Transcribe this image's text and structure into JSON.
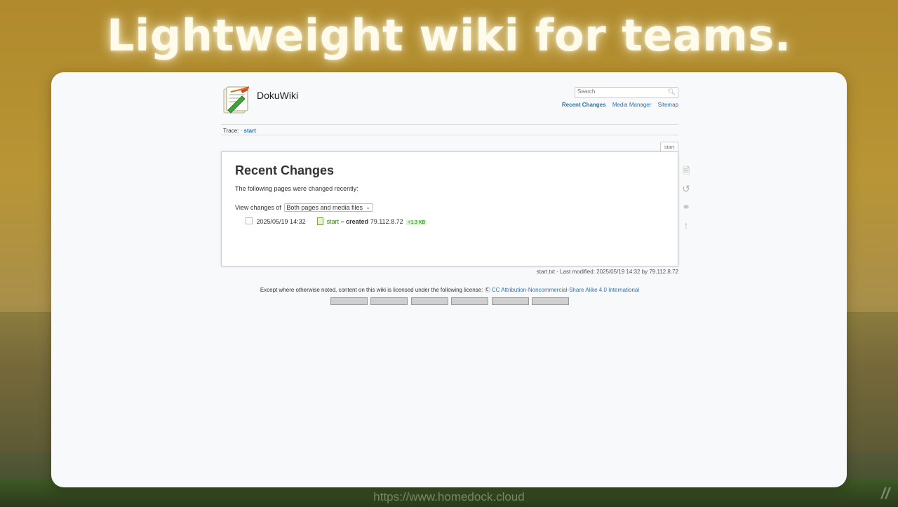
{
  "headline": "Lightweight wiki for teams.",
  "watermark": "https://www.homedock.cloud",
  "wiki": {
    "site_title": "DokuWiki",
    "search_placeholder": "Search",
    "top_links": [
      "Recent Changes",
      "Media Manager",
      "Sitemap"
    ],
    "trace_label": "Trace:",
    "trace_sep": "·",
    "trace_link": "start",
    "page_tab": "start",
    "heading": "Recent Changes",
    "intro": "The following pages were changed recently:",
    "view_changes_label": "View changes of",
    "view_changes_selected": "Both pages and media files",
    "changes": [
      {
        "date": "2025/05/19 14:32",
        "page": "start",
        "action": "– created",
        "ip": "79.112.8.72",
        "size_delta": "+1.3 KB"
      }
    ],
    "doc_info": "start.txt · Last modified: 2025/05/19 14:32 by 79.112.8.72",
    "license_text": "Except where otherwise noted, content on this wiki is licensed under the following license:",
    "license_link": "CC Attribution-Noncommercial-Share Alike 4.0 International",
    "side_tools": [
      "page-icon",
      "history-icon",
      "backlinks-icon",
      "back-to-top-icon"
    ],
    "footer_badges": [
      "cc-badge",
      "donate-badge",
      "php-badge",
      "html5-badge",
      "css-badge",
      "dokuwiki-badge"
    ]
  }
}
